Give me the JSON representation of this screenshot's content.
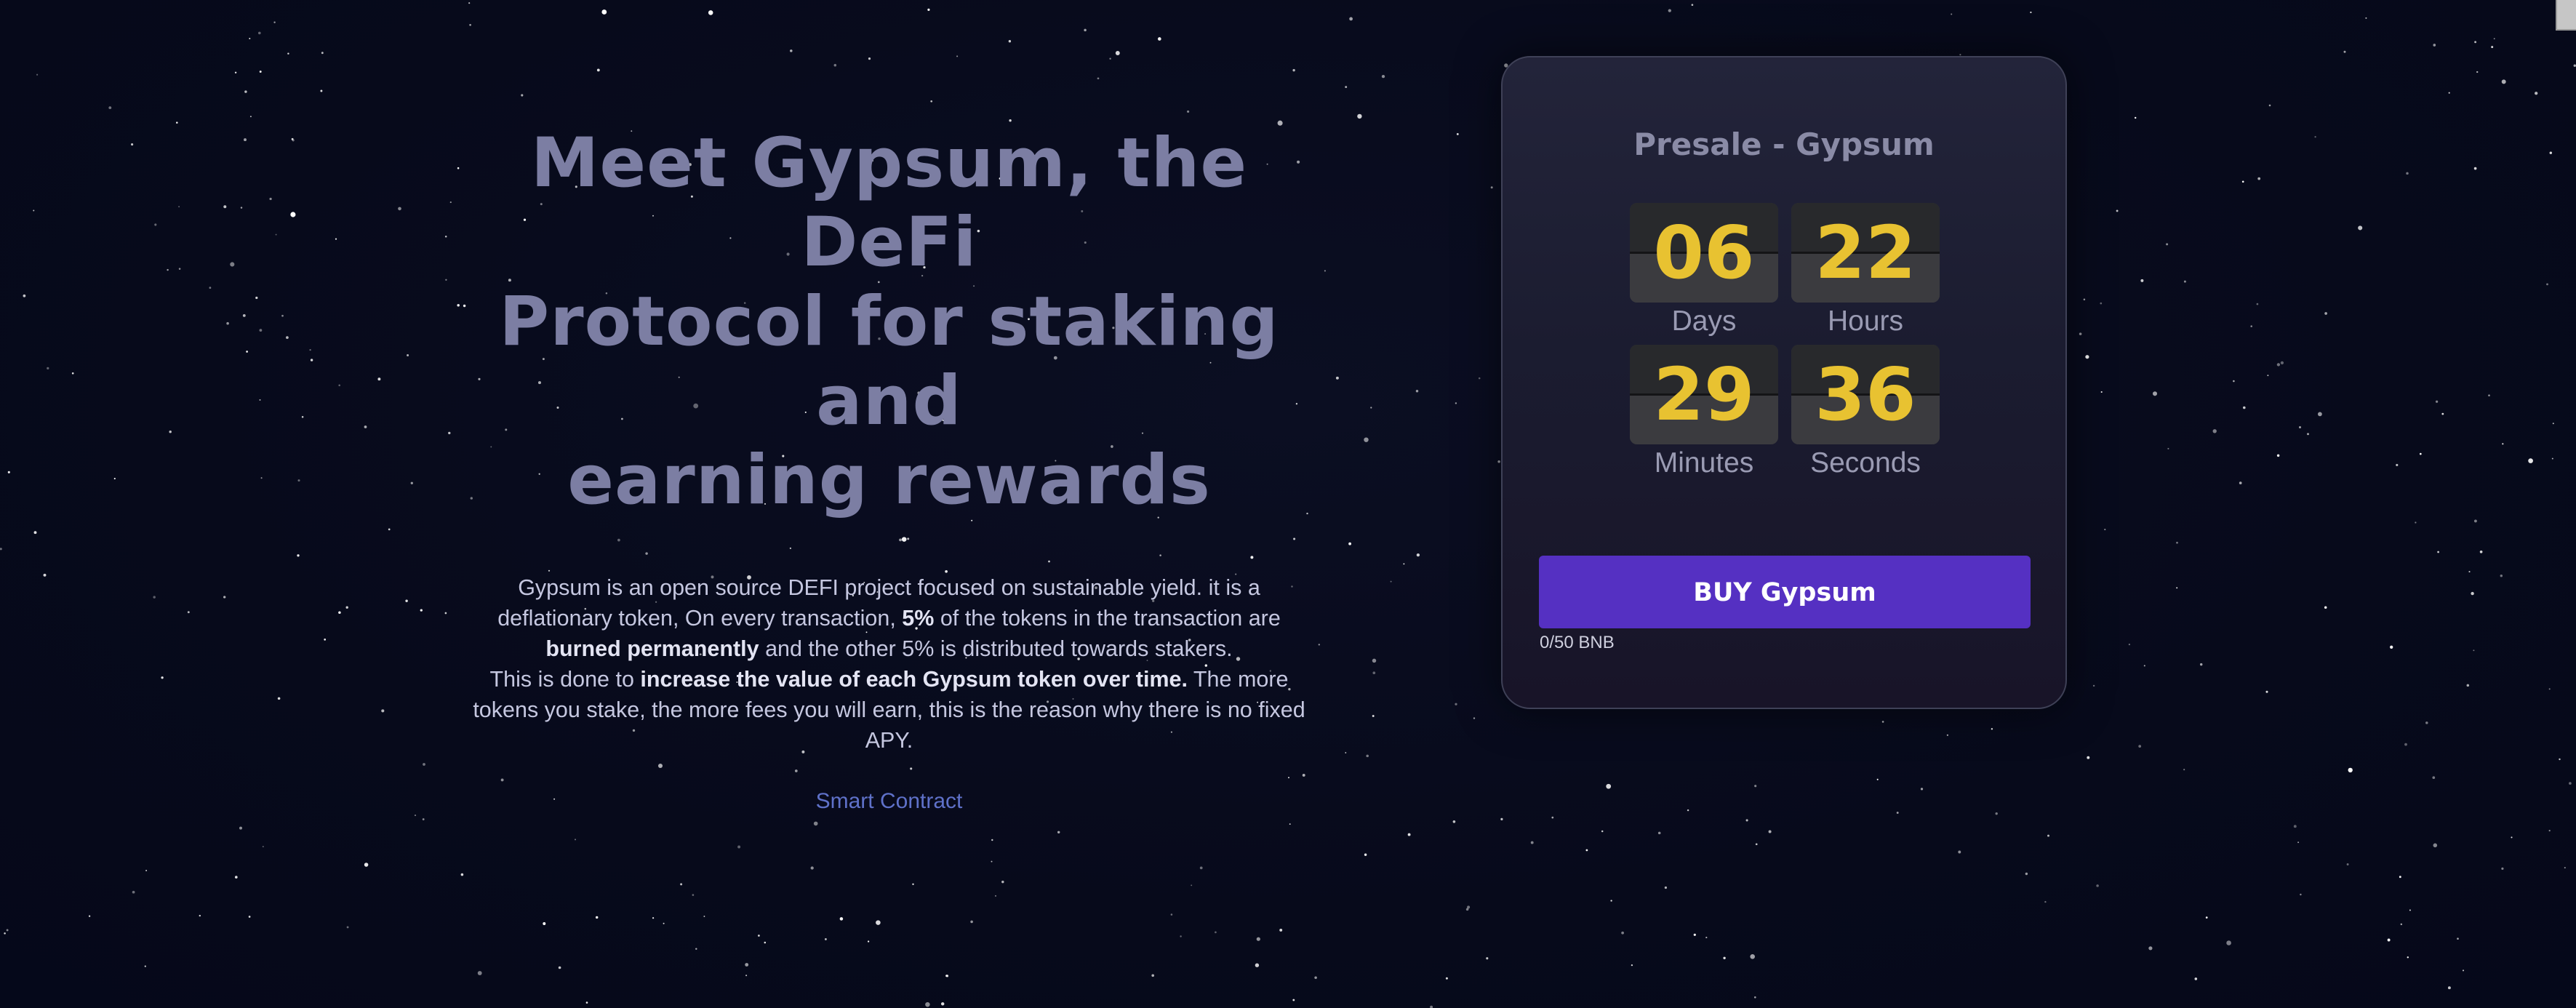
{
  "hero": {
    "title_line1": "Meet Gypsum, the DeFi",
    "title_line2": "Protocol for staking and",
    "title_line3": "earning rewards",
    "desc": {
      "p1": "Gypsum is an open source DEFI project focused on sustainable yield. it is a deflationary token, On every transaction, ",
      "b1": "5%",
      "p2": " of the tokens in the transaction are ",
      "b2": "burned permanently",
      "p3": " and the other 5% is distributed towards stakers.",
      "p4": "This is done to ",
      "b3": "increase the value of each Gypsum token over time.",
      "p5": " The more tokens you stake, the more fees you will earn, this is the reason why there is no fixed APY."
    },
    "smart_contract_label": "Smart Contract"
  },
  "presale": {
    "title": "Presale - Gypsum",
    "countdown": [
      {
        "value": "06",
        "label": "Days"
      },
      {
        "value": "22",
        "label": "Hours"
      },
      {
        "value": "29",
        "label": "Minutes"
      },
      {
        "value": "36",
        "label": "Seconds"
      }
    ],
    "buy_label": "BUY Gypsum",
    "raised": "0/50 BNB"
  },
  "colors": {
    "background": "#070a1b",
    "title": "#7c7ea3",
    "digit": "#e8c231",
    "button": "#5530c2",
    "link": "#5f71c9"
  }
}
